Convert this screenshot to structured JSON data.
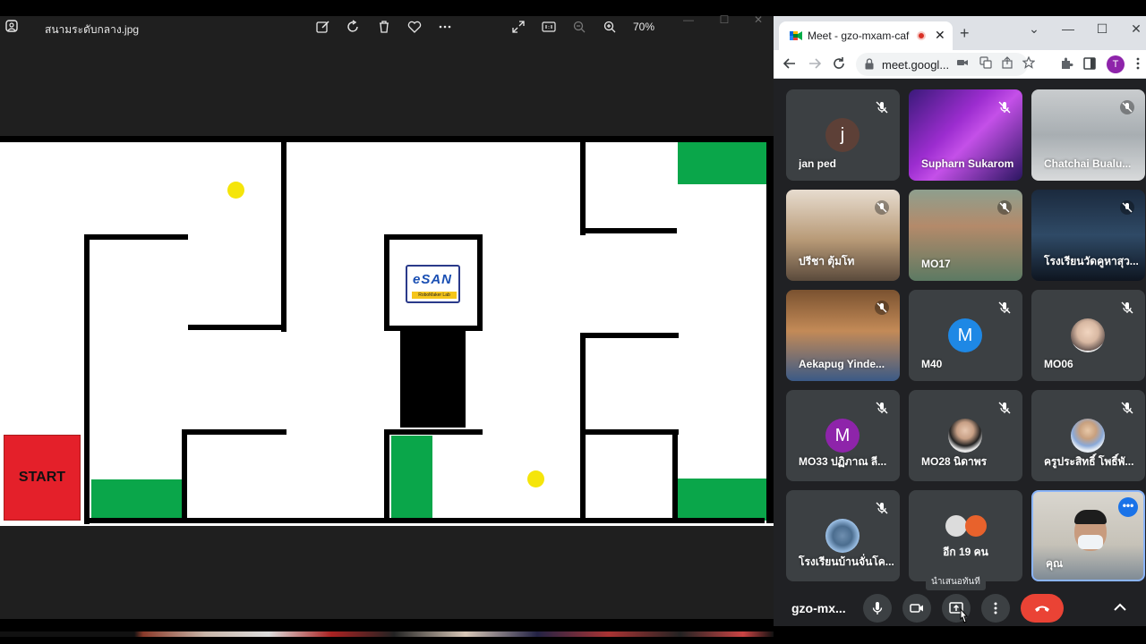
{
  "viewer": {
    "title": "สนามระดับกลาง.jpg",
    "zoom": "70%",
    "icons": [
      "photo-app-icon",
      "edit-icon",
      "rotate-icon",
      "delete-icon",
      "favorite-icon",
      "more-icon",
      "fullscreen-icon",
      "actual-size-icon",
      "zoom-out-icon",
      "zoom-in-icon"
    ]
  },
  "maze": {
    "start_label": "START",
    "logo_text": "eSAN",
    "logo_subtext": "RoboMaker Lab",
    "colors": {
      "green": "#0aa64a",
      "start": "#e4202a",
      "dot": "#f5e50a"
    }
  },
  "chrome": {
    "tab_title": "Meet - gzo-mxam-caf",
    "url": "meet.googl...",
    "profile_initial": "T"
  },
  "meet": {
    "participants": [
      {
        "name": "jan ped",
        "avatar": "j",
        "avatar_color": "#5d4037",
        "muted": true
      },
      {
        "name": "Supharn Sukarom",
        "muted": true,
        "video": true
      },
      {
        "name": "Chatchai Bualu...",
        "muted": true,
        "video": true
      },
      {
        "name": "ปรีชา ตุ้มโท",
        "muted": true,
        "video": true
      },
      {
        "name": "MO17",
        "muted": true,
        "video": true
      },
      {
        "name": "โรงเรียนวัดคูหาสุว...",
        "muted": true,
        "video": true
      },
      {
        "name": "Aekapug Yinde...",
        "muted": true,
        "video": true
      },
      {
        "name": "M40",
        "avatar": "M",
        "avatar_color": "#1e88e5",
        "muted": true
      },
      {
        "name": "MO06",
        "muted": true,
        "photo": true
      },
      {
        "name": "MO33 ปฏิภาณ ลี...",
        "avatar": "M",
        "avatar_color": "#8e24aa",
        "muted": true
      },
      {
        "name": "MO28 นิดาพร",
        "muted": true,
        "photo": true
      },
      {
        "name": "ครูประสิทธิ์ โพธิ์พั...",
        "muted": true,
        "photo": true
      },
      {
        "name": "โรงเรียนบ้านจั่นโค...",
        "muted": true,
        "photo": true
      }
    ],
    "others_label": "อีก 19 คน",
    "self_label": "คุณ",
    "tooltip": "นำเสนอทันที",
    "meeting_code": "gzo-mx...",
    "colors": {
      "end_call": "#ea4335",
      "self_border": "#8ab4f8"
    }
  }
}
